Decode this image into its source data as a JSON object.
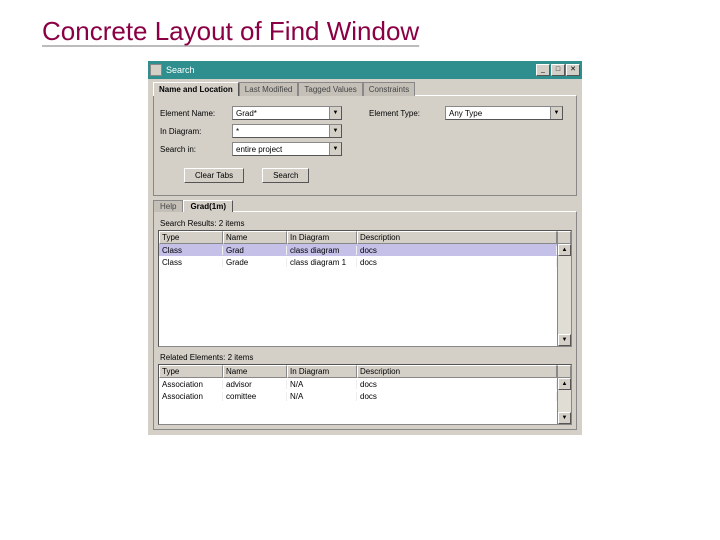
{
  "slide_title": "Concrete Layout of Find Window",
  "window": {
    "title": "Search",
    "tabs": {
      "t1": "Name and Location",
      "t2": "Last Modified",
      "t3": "Tagged Values",
      "t4": "Constraints"
    },
    "form": {
      "element_name_label": "Element Name:",
      "element_name_value": "Grad*",
      "in_diagram_label": "In Diagram:",
      "in_diagram_value": "*",
      "search_in_label": "Search in:",
      "search_in_value": "entire project",
      "element_type_label": "Element Type:",
      "element_type_value": "Any Type"
    },
    "buttons": {
      "clear": "Clear Tabs",
      "search": "Search"
    },
    "subtabs": {
      "help": "Help",
      "grad": "Grad(1m)"
    },
    "results": {
      "label": "Search Results: 2 items",
      "cols": {
        "type": "Type",
        "name": "Name",
        "diag": "In Diagram",
        "desc": "Description"
      },
      "rows": [
        {
          "type": "Class",
          "name": "Grad",
          "diag": "class diagram",
          "desc": "docs"
        },
        {
          "type": "Class",
          "name": "Grade",
          "diag": "class diagram 1",
          "desc": "docs"
        }
      ]
    },
    "related": {
      "label": "Related Elements: 2 items",
      "rows": [
        {
          "type": "Association",
          "name": "advisor",
          "diag": "N/A",
          "desc": "docs"
        },
        {
          "type": "Association",
          "name": "comittee",
          "diag": "N/A",
          "desc": "docs"
        }
      ]
    }
  }
}
